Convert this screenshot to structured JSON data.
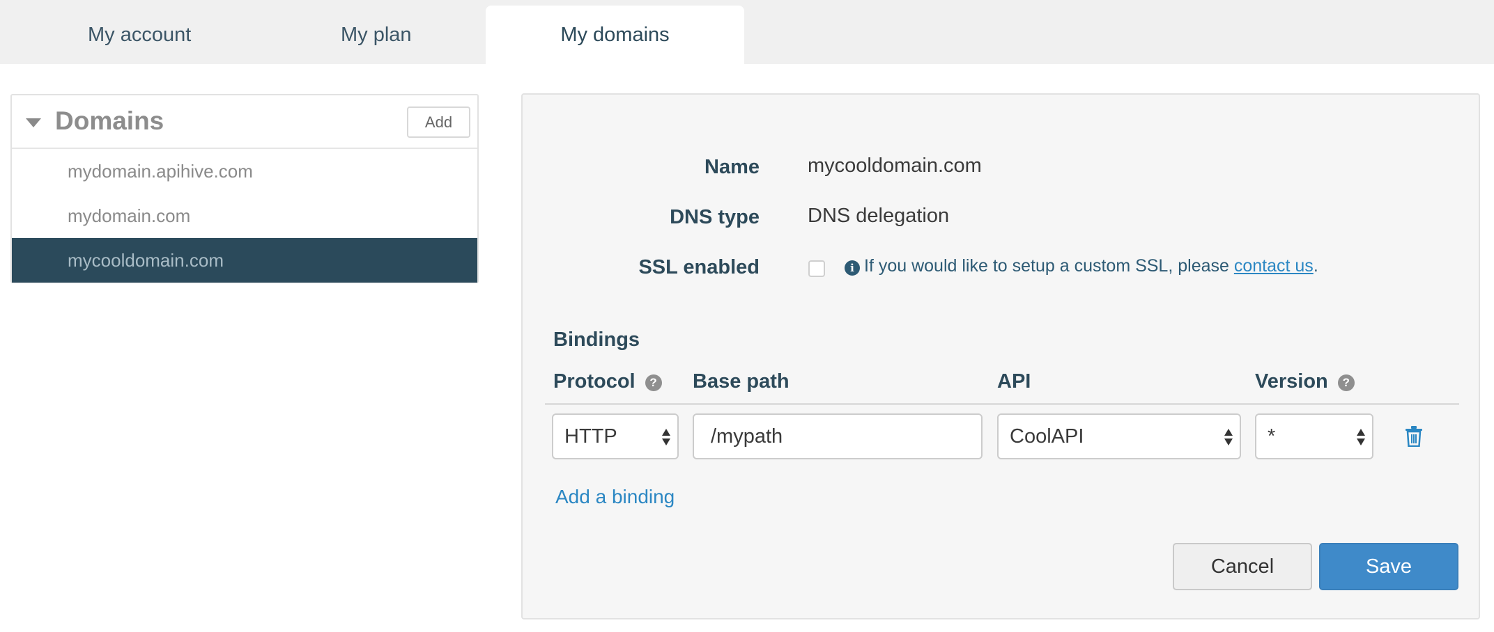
{
  "tabs": [
    {
      "label": "My account"
    },
    {
      "label": "My plan"
    },
    {
      "label": "My domains",
      "active": true
    }
  ],
  "sidebar": {
    "title": "Domains",
    "add_label": "Add",
    "items": [
      {
        "label": "mydomain.apihive.com"
      },
      {
        "label": "mydomain.com"
      },
      {
        "label": "mycooldomain.com",
        "selected": true
      }
    ]
  },
  "detail": {
    "name_label": "Name",
    "name_value": "mycooldomain.com",
    "dns_label": "DNS type",
    "dns_value": "DNS delegation",
    "ssl_label": "SSL enabled",
    "ssl_checked": false,
    "ssl_note": "If you would like to setup a custom SSL, please",
    "ssl_link": "contact us",
    "ssl_note_end": "."
  },
  "bindings": {
    "title": "Bindings",
    "columns": {
      "protocol": "Protocol",
      "base_path": "Base path",
      "api": "API",
      "version": "Version"
    },
    "rows": [
      {
        "protocol": "HTTP",
        "base_path": "/mypath",
        "api": "CoolAPI",
        "version": "*"
      }
    ],
    "add_label": "Add a binding"
  },
  "actions": {
    "cancel_label": "Cancel",
    "save_label": "Save"
  },
  "icons": {
    "caret": "caret-down-icon",
    "info": "info-icon",
    "help": "help-icon",
    "trash": "trash-icon"
  },
  "colors": {
    "selected_bg": "#2b4a5b",
    "primary": "#3f8ac9",
    "link": "#2b87c3"
  }
}
